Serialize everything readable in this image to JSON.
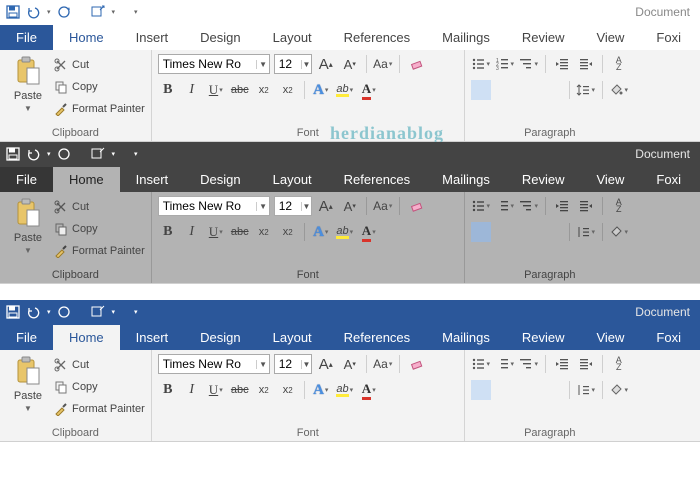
{
  "doc_title": "Document",
  "watermark": "herdianablog",
  "tabs": {
    "file": "File",
    "list": [
      "Home",
      "Insert",
      "Design",
      "Layout",
      "References",
      "Mailings",
      "Review",
      "View",
      "Foxi"
    ],
    "active": "Home"
  },
  "clipboard": {
    "paste": "Paste",
    "cut": "Cut",
    "copy": "Copy",
    "format_painter": "Format Painter",
    "group_label": "Clipboard"
  },
  "font": {
    "name_value": "Times New Ro",
    "size_value": "12",
    "grow": "A",
    "grow_sup": "▴",
    "shrink": "A",
    "shrink_sup": "▾",
    "changecase": "Aa",
    "bold": "B",
    "italic": "I",
    "underline": "U",
    "strike": "abc",
    "subscript_x": "x",
    "subscript_2": "2",
    "superscript_x": "x",
    "superscript_2": "2",
    "texteffect": "A",
    "highlight": "ab",
    "fontcolor": "A",
    "group_label": "Font"
  },
  "paragraph": {
    "sort": "A",
    "sort2": "Z",
    "group_label": "Paragraph"
  }
}
